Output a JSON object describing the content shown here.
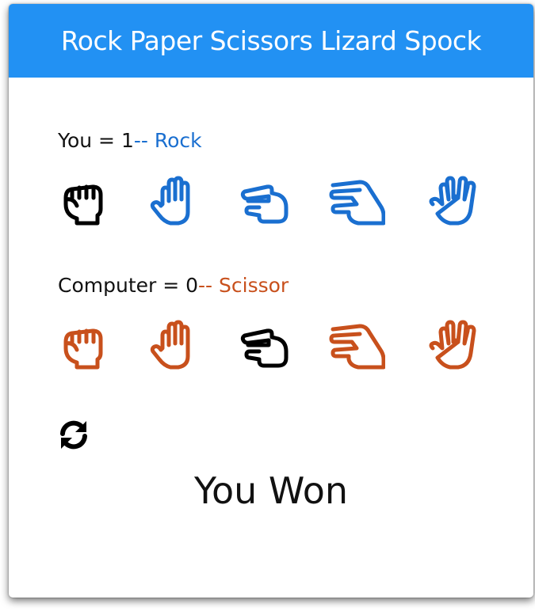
{
  "header": {
    "title": "Rock Paper Scissors Lizard Spock"
  },
  "player": {
    "label": "You",
    "equals": " = ",
    "score": "1",
    "separator": "-- ",
    "choice": "Rock"
  },
  "computer": {
    "label": "Computer",
    "equals": " = ",
    "score": "0",
    "separator": "-- ",
    "choice": "Scissor"
  },
  "hands": [
    "rock",
    "paper",
    "scissors",
    "lizard",
    "spock"
  ],
  "player_row": {
    "color": "#1a6fd0",
    "selected_color": "#000000",
    "selected": "rock",
    "icons": [
      "rock-hand-icon",
      "paper-hand-icon",
      "scissors-hand-icon",
      "lizard-hand-icon",
      "spock-hand-icon"
    ]
  },
  "computer_row": {
    "color": "#c8501c",
    "selected_color": "#000000",
    "selected": "scissors",
    "icons": [
      "rock-hand-icon",
      "paper-hand-icon",
      "scissors-hand-icon",
      "lizard-hand-icon",
      "spock-hand-icon"
    ]
  },
  "reset": {
    "icon": "refresh-icon"
  },
  "result": {
    "text": "You Won"
  },
  "colors": {
    "header_bg": "#2291f3",
    "player_accent": "#1a6fd0",
    "computer_accent": "#c8501c"
  }
}
